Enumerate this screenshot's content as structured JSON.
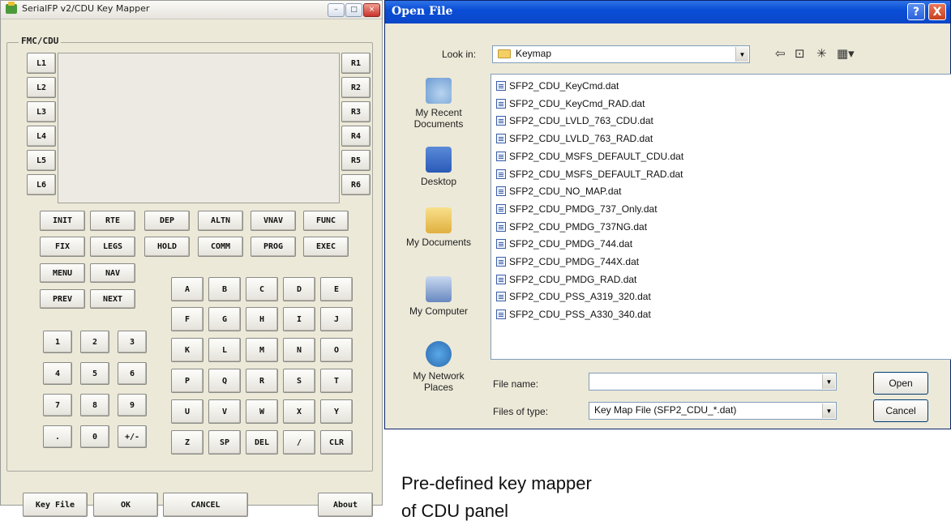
{
  "left_window": {
    "title": "SerialFP v2/CDU Key Mapper",
    "title_buttons": [
      "–",
      "□",
      "×"
    ],
    "group_label": "FMC/CDU",
    "lsk_left": [
      "L1",
      "L2",
      "L3",
      "L4",
      "L5",
      "L6"
    ],
    "lsk_right": [
      "R1",
      "R2",
      "R3",
      "R4",
      "R5",
      "R6"
    ],
    "func_row1": [
      "INIT",
      "RTE",
      "DEP",
      "ALTN",
      "VNAV",
      "FUNC"
    ],
    "func_row2": [
      "FIX",
      "LEGS",
      "HOLD",
      "COMM",
      "PROG",
      "EXEC"
    ],
    "menu_keys": [
      "MENU",
      "NAV",
      "PREV",
      "NEXT"
    ],
    "num_keys": [
      "1",
      "2",
      "3",
      "4",
      "5",
      "6",
      "7",
      "8",
      "9",
      ".",
      "0",
      "+/-"
    ],
    "alpha_keys": [
      "A",
      "B",
      "C",
      "D",
      "E",
      "F",
      "G",
      "H",
      "I",
      "J",
      "K",
      "L",
      "M",
      "N",
      "O",
      "P",
      "Q",
      "R",
      "S",
      "T",
      "U",
      "V",
      "W",
      "X",
      "Y",
      "Z",
      "SP",
      "DEL",
      "/",
      "CLR"
    ],
    "bottom": {
      "key_file": "Key File",
      "ok": "OK",
      "cancel": "CANCEL",
      "about": "About"
    }
  },
  "dialog": {
    "title": "Open File",
    "help_button": "?",
    "close_button": "X",
    "look_in_label": "Look in:",
    "look_in_value": "Keymap",
    "toolbar_icons": [
      "back-icon",
      "up-folder-icon",
      "new-folder-icon",
      "view-menu-icon"
    ],
    "places": [
      "My Recent Documents",
      "Desktop",
      "My Documents",
      "My Computer",
      "My Network Places"
    ],
    "files": [
      "SFP2_CDU_KeyCmd.dat",
      "SFP2_CDU_KeyCmd_RAD.dat",
      "SFP2_CDU_LVLD_763_CDU.dat",
      "SFP2_CDU_LVLD_763_RAD.dat",
      "SFP2_CDU_MSFS_DEFAULT_CDU.dat",
      "SFP2_CDU_MSFS_DEFAULT_RAD.dat",
      "SFP2_CDU_NO_MAP.dat",
      "SFP2_CDU_PMDG_737_Only.dat",
      "SFP2_CDU_PMDG_737NG.dat",
      "SFP2_CDU_PMDG_744.dat",
      "SFP2_CDU_PMDG_744X.dat",
      "SFP2_CDU_PMDG_RAD.dat",
      "SFP2_CDU_PSS_A319_320.dat",
      "SFP2_CDU_PSS_A330_340.dat"
    ],
    "file_name_label": "File name:",
    "file_name_value": "",
    "files_of_type_label": "Files of type:",
    "files_of_type_value": "Key Map File (SFP2_CDU_*.dat)",
    "open_button": "Open",
    "cancel_button": "Cancel"
  },
  "caption": "Pre-defined key mapper\nof CDU panel"
}
